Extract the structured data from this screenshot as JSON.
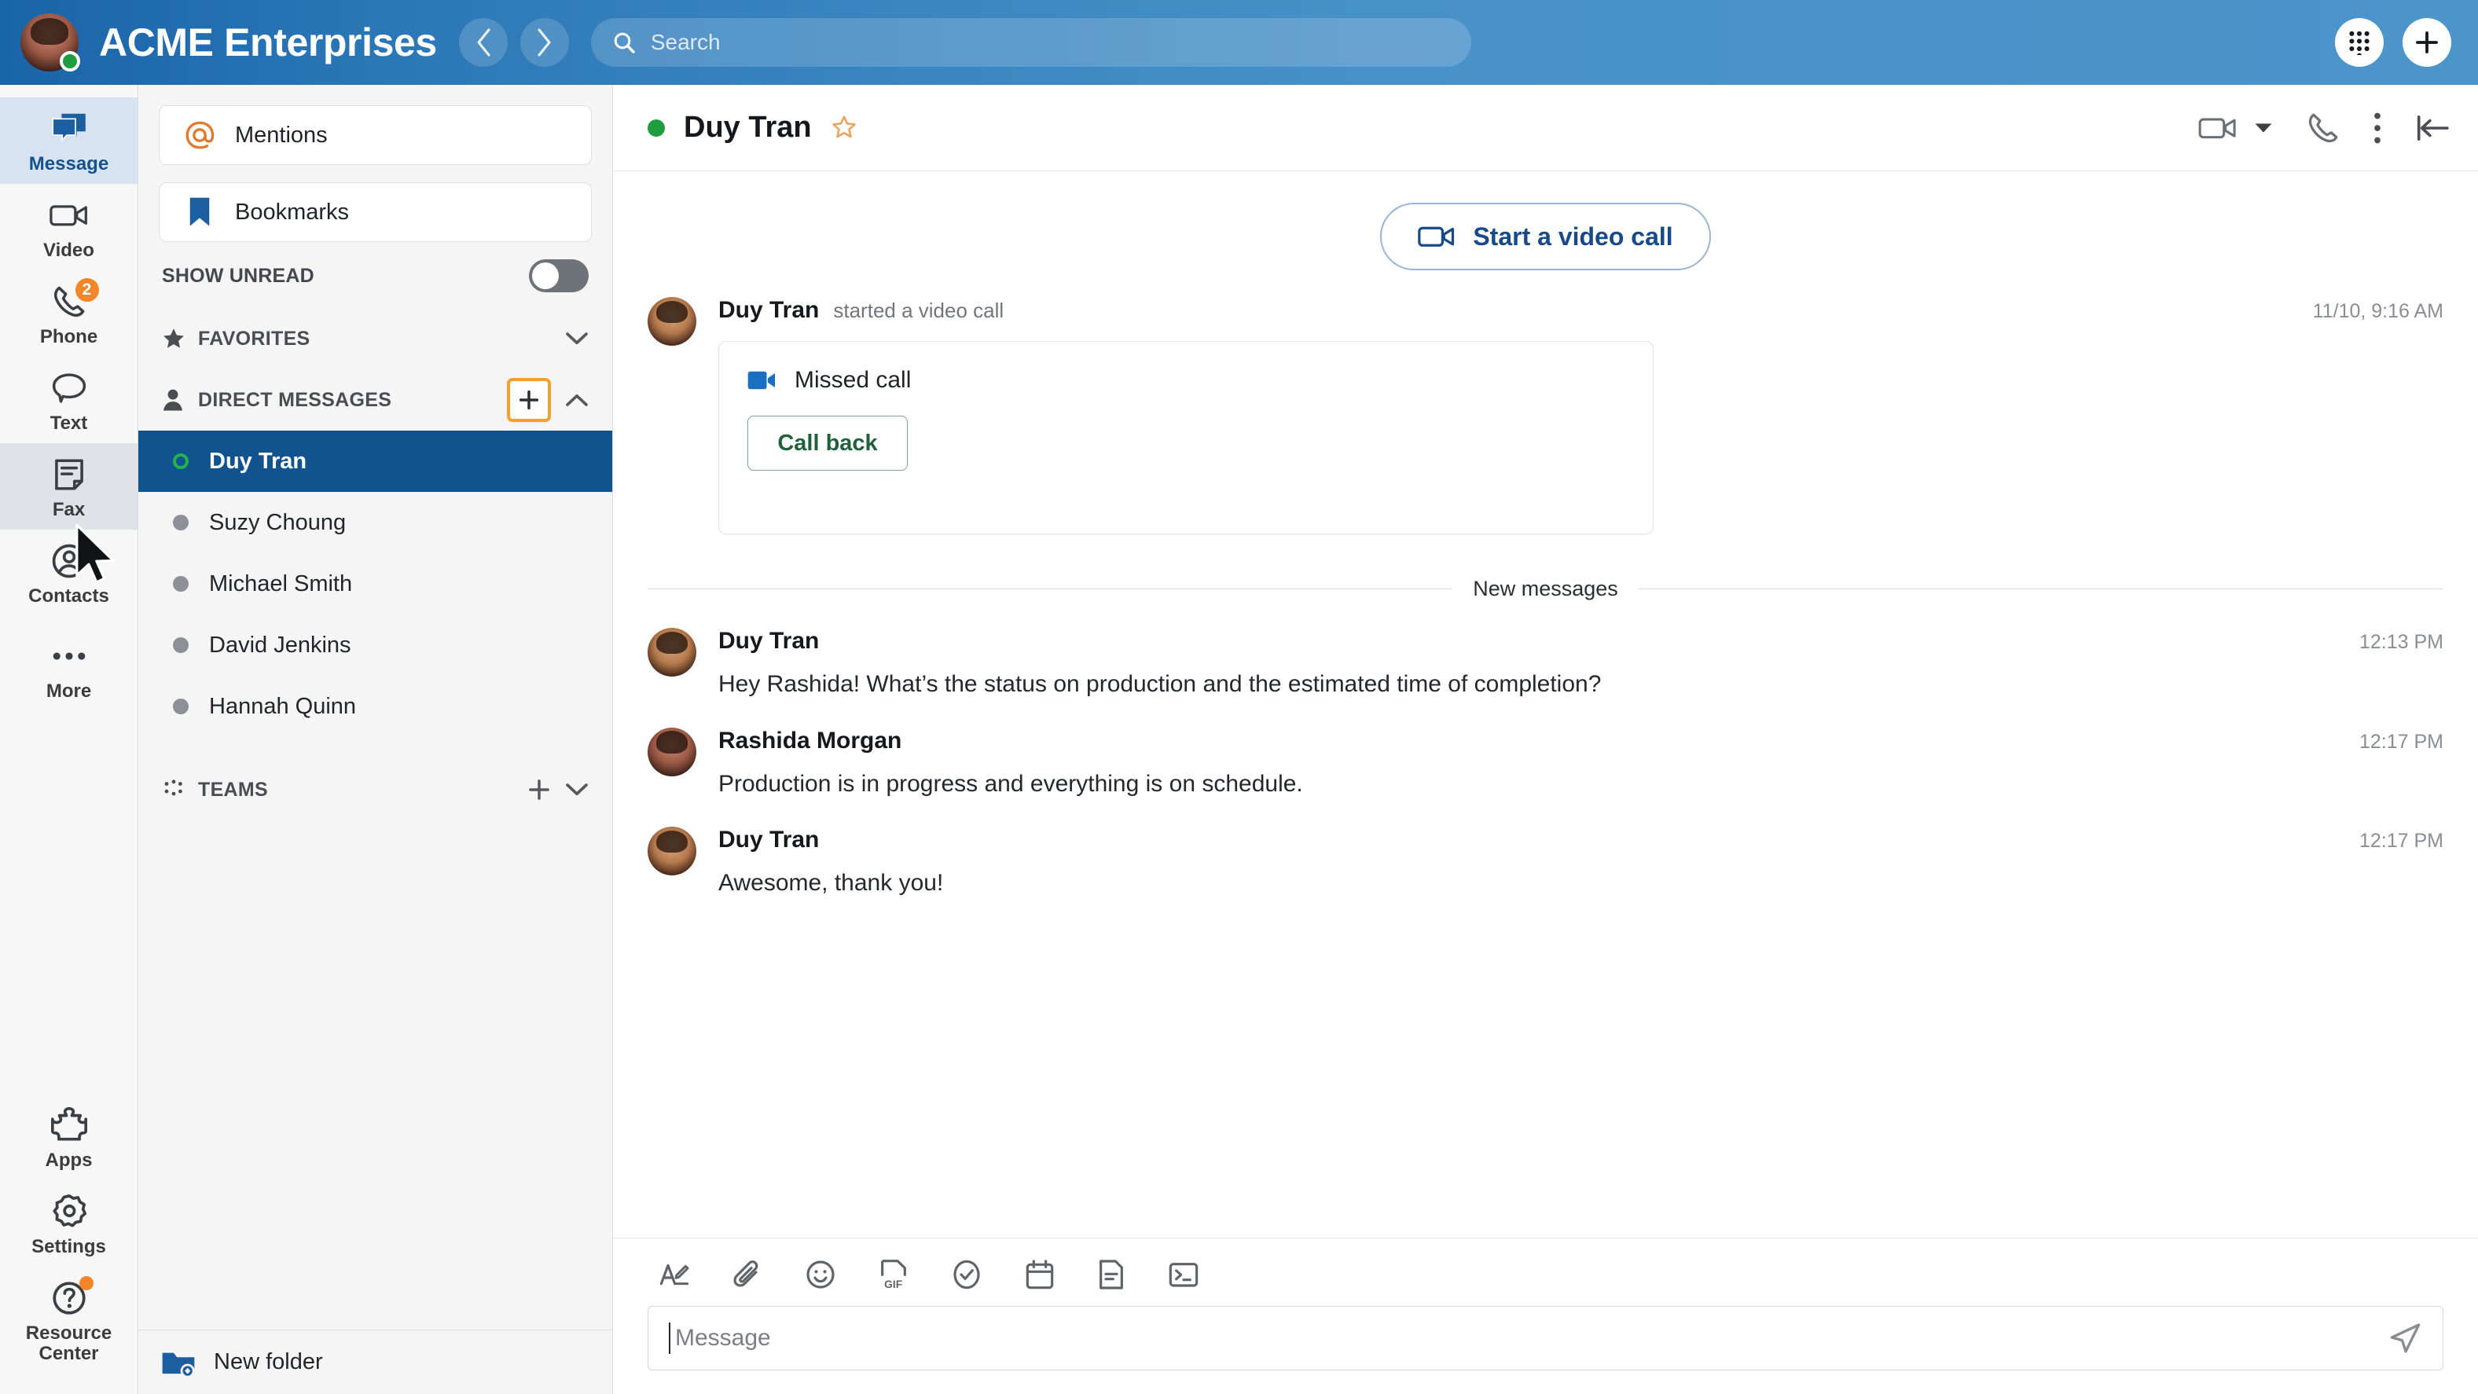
{
  "topbar": {
    "brand": "ACME Enterprises",
    "user_presence": "online",
    "back_icon": "chevron-left-icon",
    "forward_icon": "chevron-right-icon",
    "search": {
      "placeholder": "Search",
      "value": "",
      "icon": "search-icon"
    },
    "dialpad_icon": "dialpad-icon",
    "add_icon": "plus-icon",
    "accent": "#3f88c5"
  },
  "rail": {
    "items": [
      {
        "label": "Message",
        "icon": "message-bubbles-icon",
        "state": "active"
      },
      {
        "label": "Video",
        "icon": "video-camera-icon",
        "state": "default"
      },
      {
        "label": "Phone",
        "icon": "phone-handset-icon",
        "state": "default",
        "badge": "2"
      },
      {
        "label": "Text",
        "icon": "speech-bubble-icon",
        "state": "default"
      },
      {
        "label": "Fax",
        "icon": "fax-document-icon",
        "state": "hover"
      },
      {
        "label": "Contacts",
        "icon": "user-circle-icon",
        "state": "default"
      },
      {
        "label": "More",
        "icon": "ellipsis-icon",
        "state": "default"
      }
    ],
    "bottom_items": [
      {
        "label": "Apps",
        "icon": "puzzle-piece-icon",
        "state": "default"
      },
      {
        "label": "Settings",
        "icon": "gear-icon",
        "state": "default"
      },
      {
        "label": "Resource Center",
        "icon": "question-circle-icon",
        "state": "default",
        "dot": true
      }
    ]
  },
  "panel": {
    "mentions": {
      "label": "Mentions",
      "icon": "at-sign-icon"
    },
    "bookmarks": {
      "label": "Bookmarks",
      "icon": "bookmark-icon"
    },
    "show_unread": {
      "label": "SHOW UNREAD",
      "state": "off"
    },
    "favorites": {
      "label": "FAVORITES",
      "icon": "star-icon",
      "chevron": "chevron-down-icon"
    },
    "direct_messages": {
      "label": "DIRECT MESSAGES",
      "icon": "person-icon",
      "add_icon": "plus-icon",
      "add_highlight_color": "#f2a12a",
      "chevron": "chevron-up-icon",
      "items": [
        {
          "name": "Duy Tran",
          "presence": "online",
          "selected": true
        },
        {
          "name": "Suzy Choung",
          "presence": "offline",
          "selected": false
        },
        {
          "name": "Michael Smith",
          "presence": "offline",
          "selected": false
        },
        {
          "name": "David Jenkins",
          "presence": "offline",
          "selected": false
        },
        {
          "name": "Hannah Quinn",
          "presence": "offline",
          "selected": false
        }
      ]
    },
    "teams": {
      "label": "TEAMS",
      "icon": "teams-dots-icon",
      "add_icon": "plus-icon",
      "chevron": "chevron-down-icon"
    },
    "footer": {
      "label": "New folder",
      "icon": "new-folder-icon"
    }
  },
  "conversation": {
    "title": "Duy Tran",
    "presence": "online",
    "star_icon": "star-outline-icon",
    "actions": [
      {
        "icon": "video-camera-icon"
      },
      {
        "icon": "chevron-down-icon"
      },
      {
        "icon": "phone-handset-icon"
      },
      {
        "icon": "kebab-menu-icon"
      },
      {
        "icon": "collapse-panel-icon"
      }
    ],
    "start_video_call": {
      "label": "Start a video call",
      "icon": "video-camera-icon"
    },
    "new_messages_divider": "New messages",
    "messages": [
      {
        "author": "Duy Tran",
        "subtext": "started a video call",
        "time": "11/10, 9:16 AM",
        "card": {
          "title": "Missed call",
          "icon": "video-camera-filled-icon",
          "button": "Call back"
        }
      },
      {
        "author": "Duy Tran",
        "time": "12:13 PM",
        "text": "Hey Rashida! What’s the status on production and the estimated time of completion?"
      },
      {
        "author": "Rashida Morgan",
        "time": "12:17 PM",
        "text": "Production is in progress and everything is on schedule."
      },
      {
        "author": "Duy Tran",
        "time": "12:17 PM",
        "text": "Awesome, thank you!"
      }
    ]
  },
  "composer": {
    "tools": [
      {
        "icon": "text-format-icon"
      },
      {
        "icon": "paperclip-icon"
      },
      {
        "icon": "emoji-smiley-icon"
      },
      {
        "icon": "gif-icon"
      },
      {
        "icon": "task-check-icon"
      },
      {
        "icon": "calendar-icon"
      },
      {
        "icon": "note-icon"
      },
      {
        "icon": "code-terminal-icon"
      }
    ],
    "input": {
      "placeholder": "Message",
      "value": ""
    },
    "send_icon": "send-paper-plane-icon"
  }
}
